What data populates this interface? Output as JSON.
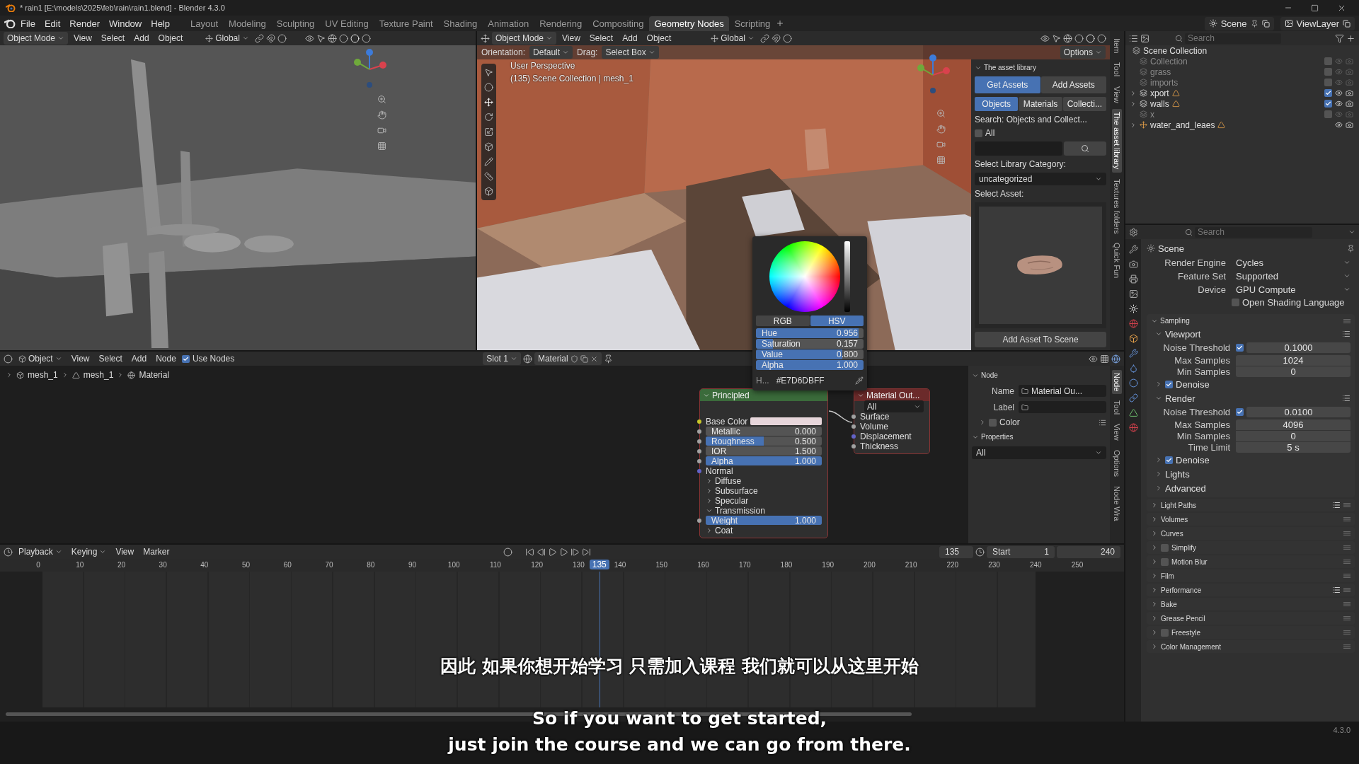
{
  "window": {
    "title": "* rain1 [E:\\models\\2025\\feb\\rain\\rain1.blend] - Blender 4.3.0"
  },
  "menu": [
    "File",
    "Edit",
    "Render",
    "Window",
    "Help"
  ],
  "workspaces": [
    {
      "label": "Layout",
      "selected": false
    },
    {
      "label": "Modeling",
      "selected": false
    },
    {
      "label": "Sculpting",
      "selected": false
    },
    {
      "label": "UV Editing",
      "selected": false
    },
    {
      "label": "Texture Paint",
      "selected": false
    },
    {
      "label": "Shading",
      "selected": false
    },
    {
      "label": "Animation",
      "selected": false
    },
    {
      "label": "Rendering",
      "selected": false
    },
    {
      "label": "Compositing",
      "selected": false
    },
    {
      "label": "Geometry Nodes",
      "selected": true
    },
    {
      "label": "Scripting",
      "selected": false
    }
  ],
  "scene": "Scene",
  "view_layer": "ViewLayer",
  "viewport_left": {
    "mode": "Object Mode",
    "menus": [
      "View",
      "Select",
      "Add",
      "Object"
    ],
    "orientation": "Global"
  },
  "viewport_right": {
    "mode": "Object Mode",
    "menus": [
      "View",
      "Select",
      "Add",
      "Object"
    ],
    "orientation": "Global",
    "settings": [
      {
        "label": "Orientation:",
        "value": "Default"
      },
      {
        "label": "Drag:",
        "value": "Select Box"
      }
    ],
    "options": "Options",
    "overlay": [
      "User Perspective",
      "(135) Scene Collection | mesh_1"
    ]
  },
  "asset_library": {
    "title": "The asset library",
    "actions": [
      {
        "label": "Get Assets",
        "selected": true
      },
      {
        "label": "Add Assets",
        "selected": false
      }
    ],
    "types": [
      {
        "label": "Objects",
        "selected": true
      },
      {
        "label": "Materials",
        "selected": false
      },
      {
        "label": "Collecti...",
        "selected": false
      }
    ],
    "search_label": "Search: Objects and Collect...",
    "all": {
      "label": "All",
      "checked": false
    },
    "category_label": "Select Library Category:",
    "category": "uncategorized",
    "asset_label": "Select Asset:",
    "add_button": "Add Asset To Scene"
  },
  "viewport_tabs": [
    {
      "label": "Item",
      "selected": false
    },
    {
      "label": "Tool",
      "selected": false
    },
    {
      "label": "View",
      "selected": false
    },
    {
      "label": "The asset library",
      "selected": true
    },
    {
      "label": "Textures folders",
      "selected": false
    },
    {
      "label": "Quick Fun",
      "selected": false
    }
  ],
  "outliner": {
    "placeholder": "Search",
    "root": "Scene Collection",
    "items": [
      {
        "label": "Collection",
        "kind": "collection",
        "checked": false,
        "expandable": false
      },
      {
        "label": "grass",
        "kind": "collection",
        "checked": false,
        "expandable": false
      },
      {
        "label": "imports",
        "kind": "collection",
        "checked": false,
        "expandable": false
      },
      {
        "label": "xport",
        "kind": "collection",
        "checked": true,
        "expandable": true
      },
      {
        "label": "walls",
        "kind": "collection",
        "checked": true,
        "expandable": true
      },
      {
        "label": "x",
        "kind": "collection",
        "checked": false,
        "expandable": false
      },
      {
        "label": "water_and_leaes",
        "kind": "object",
        "expandable": true
      }
    ]
  },
  "properties": {
    "placeholder": "Search",
    "title": "Scene",
    "rows": [
      {
        "label": "Render Engine",
        "value": "Cycles"
      },
      {
        "label": "Feature Set",
        "value": "Supported"
      },
      {
        "label": "Device",
        "value": "GPU Compute"
      }
    ],
    "osl": {
      "label": "Open Shading Language",
      "checked": false
    },
    "sampling": {
      "title": "Sampling",
      "groups": [
        {
          "title": "Viewport",
          "threshold": {
            "label": "Noise Threshold",
            "checked": true,
            "value": "0.1000"
          },
          "fields": [
            {
              "label": "Max Samples",
              "value": "1024"
            },
            {
              "label": "Min Samples",
              "value": "0"
            }
          ],
          "denoise": {
            "label": "Denoise",
            "checked": true
          }
        },
        {
          "title": "Render",
          "threshold": {
            "label": "Noise Threshold",
            "checked": true,
            "value": "0.0100"
          },
          "fields": [
            {
              "label": "Max Samples",
              "value": "4096"
            },
            {
              "label": "Min Samples",
              "value": "0"
            },
            {
              "label": "Time Limit",
              "value": "5 s"
            }
          ],
          "denoise": {
            "label": "Denoise",
            "checked": true
          }
        }
      ],
      "subpanels": [
        "Lights",
        "Advanced"
      ]
    },
    "panels": [
      {
        "title": "Light Paths",
        "kind": "plain",
        "presets": true
      },
      {
        "title": "Volumes",
        "kind": "plain",
        "presets": false
      },
      {
        "title": "Curves",
        "kind": "plain",
        "presets": false
      },
      {
        "title": "Simplify",
        "kind": "toggle",
        "checked": false,
        "presets": false
      },
      {
        "title": "Motion Blur",
        "kind": "toggle",
        "checked": false,
        "presets": false
      },
      {
        "title": "Film",
        "kind": "plain",
        "presets": false
      },
      {
        "title": "Performance",
        "kind": "plain",
        "presets": true
      },
      {
        "title": "Bake",
        "kind": "plain",
        "presets": false
      },
      {
        "title": "Grease Pencil",
        "kind": "plain",
        "presets": false
      },
      {
        "title": "Freestyle",
        "kind": "toggle",
        "checked": false,
        "presets": false
      },
      {
        "title": "Color Management",
        "kind": "plain",
        "presets": false
      }
    ]
  },
  "node_editor": {
    "object": "Object",
    "menus": [
      "View",
      "Select",
      "Add",
      "Node"
    ],
    "use_nodes": {
      "label": "Use Nodes",
      "checked": true
    },
    "slot": "Slot 1",
    "material": "Material",
    "breadcrumb": [
      "mesh_1",
      "mesh_1",
      "Material"
    ],
    "principled": {
      "title": "Principled",
      "rows": [
        {
          "kind": "color",
          "label": "Base Color",
          "color": "#e7d6db"
        },
        {
          "kind": "number",
          "label": "Metallic",
          "value": "0.000"
        },
        {
          "kind": "slider",
          "label": "Roughness",
          "value": "0.500",
          "level": 0.5
        },
        {
          "kind": "number",
          "label": "IOR",
          "value": "1.500"
        },
        {
          "kind": "slider",
          "label": "Alpha",
          "value": "1.000",
          "level": 1
        },
        {
          "kind": "socket",
          "label": "Normal"
        },
        {
          "kind": "section",
          "label": "Diffuse",
          "expanded": false
        },
        {
          "kind": "section",
          "label": "Subsurface",
          "expanded": false
        },
        {
          "kind": "section",
          "label": "Specular",
          "expanded": false
        },
        {
          "kind": "section",
          "label": "Transmission",
          "expanded": true
        },
        {
          "kind": "slider",
          "label": "Weight",
          "value": "1.000",
          "level": 1
        },
        {
          "kind": "section",
          "label": "Coat",
          "expanded": false
        }
      ]
    },
    "output": {
      "title": "Material Out...",
      "target": "All",
      "sockets": [
        "Surface",
        "Volume",
        "Displacement",
        "Thickness"
      ]
    },
    "sidebar": {
      "node_title": "Node",
      "name_label": "Name",
      "name": "Material Ou...",
      "label_label": "Label",
      "color": {
        "label": "Color",
        "checked": false
      },
      "properties_title": "Properties",
      "properties_value": "All"
    },
    "tabs": [
      {
        "label": "Node",
        "selected": true
      },
      {
        "label": "Tool",
        "selected": false
      },
      {
        "label": "View",
        "selected": false
      },
      {
        "label": "Options",
        "selected": false
      },
      {
        "label": "Node Wra",
        "selected": false
      }
    ]
  },
  "color_picker": {
    "modes": [
      {
        "label": "RGB",
        "selected": false
      },
      {
        "label": "HSV",
        "selected": true
      }
    ],
    "channels": [
      {
        "label": "Hue",
        "value": "0.956",
        "level": 0.956
      },
      {
        "label": "Saturation",
        "value": "0.157",
        "level": 0.157
      },
      {
        "label": "Value",
        "value": "0.800",
        "level": 0.8
      },
      {
        "label": "Alpha",
        "value": "1.000",
        "level": 1
      }
    ],
    "hex_label": "H...",
    "hex": "#E7D6DBFF"
  },
  "timeline": {
    "menus": [
      "Playback",
      "Keying",
      "View",
      "Marker"
    ],
    "current": "135",
    "playhead": "135",
    "start_label": "Start",
    "start": "1",
    "end": "240",
    "ticks": [
      "0",
      "10",
      "20",
      "30",
      "40",
      "50",
      "60",
      "70",
      "80",
      "90",
      "100",
      "110",
      "120",
      "130",
      "140",
      "150",
      "160",
      "170",
      "180",
      "190",
      "200",
      "210",
      "220",
      "230",
      "240",
      "250"
    ]
  },
  "subtitles": [
    "因此 如果你想开始学习 只需加入课程 我们就可以从这里开始",
    "So if you want to get started,",
    "just join the course and we can go from there."
  ],
  "status": {
    "version": "4.3.0"
  }
}
